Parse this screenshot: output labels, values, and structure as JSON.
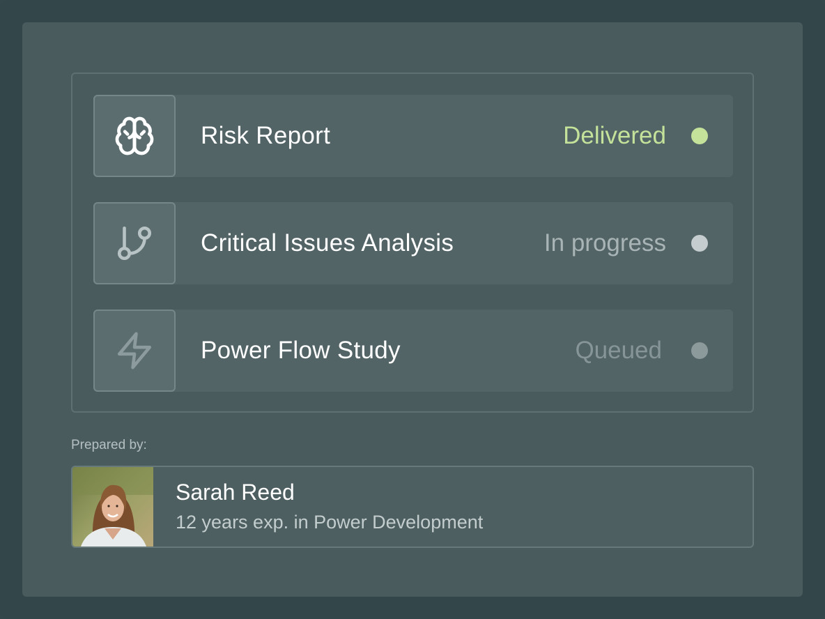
{
  "tasks": [
    {
      "title": "Risk Report",
      "status": "Delivered",
      "icon": "brain-icon",
      "status_color": "#c5e29a",
      "dot_color": "#c5e29a",
      "icon_color": "#ffffff"
    },
    {
      "title": "Critical Issues Analysis",
      "status": "In progress",
      "icon": "git-branch-icon",
      "status_color": "#a8b4b6",
      "dot_color": "#c5cdcf",
      "icon_color": "#b7c3c5"
    },
    {
      "title": "Power Flow Study",
      "status": "Queued",
      "icon": "lightning-icon",
      "status_color": "#869598",
      "dot_color": "#8c9a9c",
      "icon_color": "#8c9b9d"
    }
  ],
  "prepared_by": {
    "label": "Prepared by:",
    "name": "Sarah Reed",
    "description": "12 years exp. in Power Development",
    "avatar": "avatar-photo"
  }
}
